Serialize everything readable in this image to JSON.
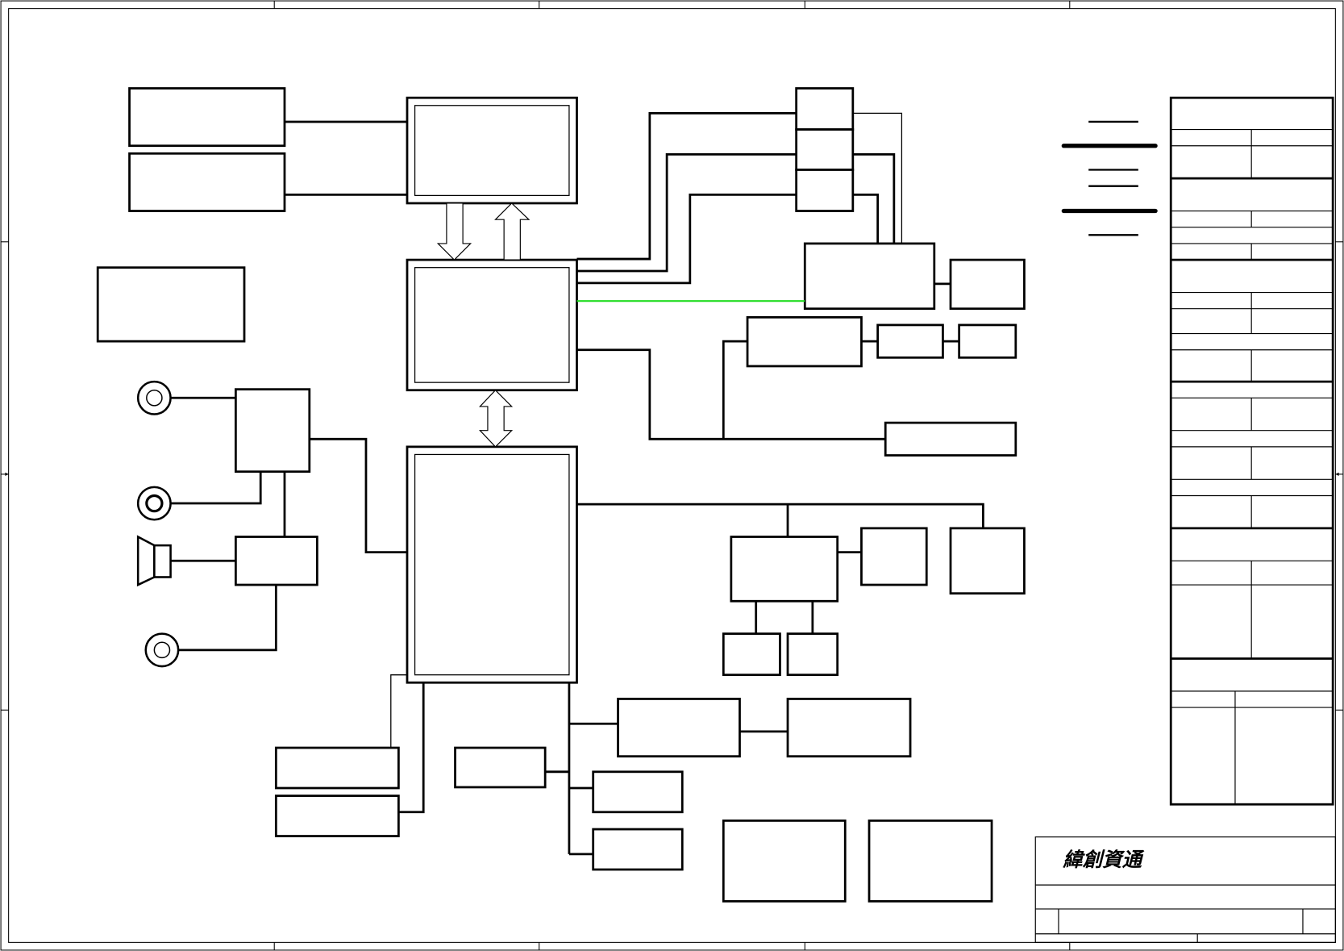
{
  "title_block": {
    "company_logo_text": "緯創資通"
  },
  "colors": {
    "line": "#000000",
    "background": "#ffffff",
    "highlight_signal": "#22dd22"
  },
  "icons": [
    "audio-jack-icon",
    "speaker-icon",
    "bus-arrow-icon"
  ]
}
